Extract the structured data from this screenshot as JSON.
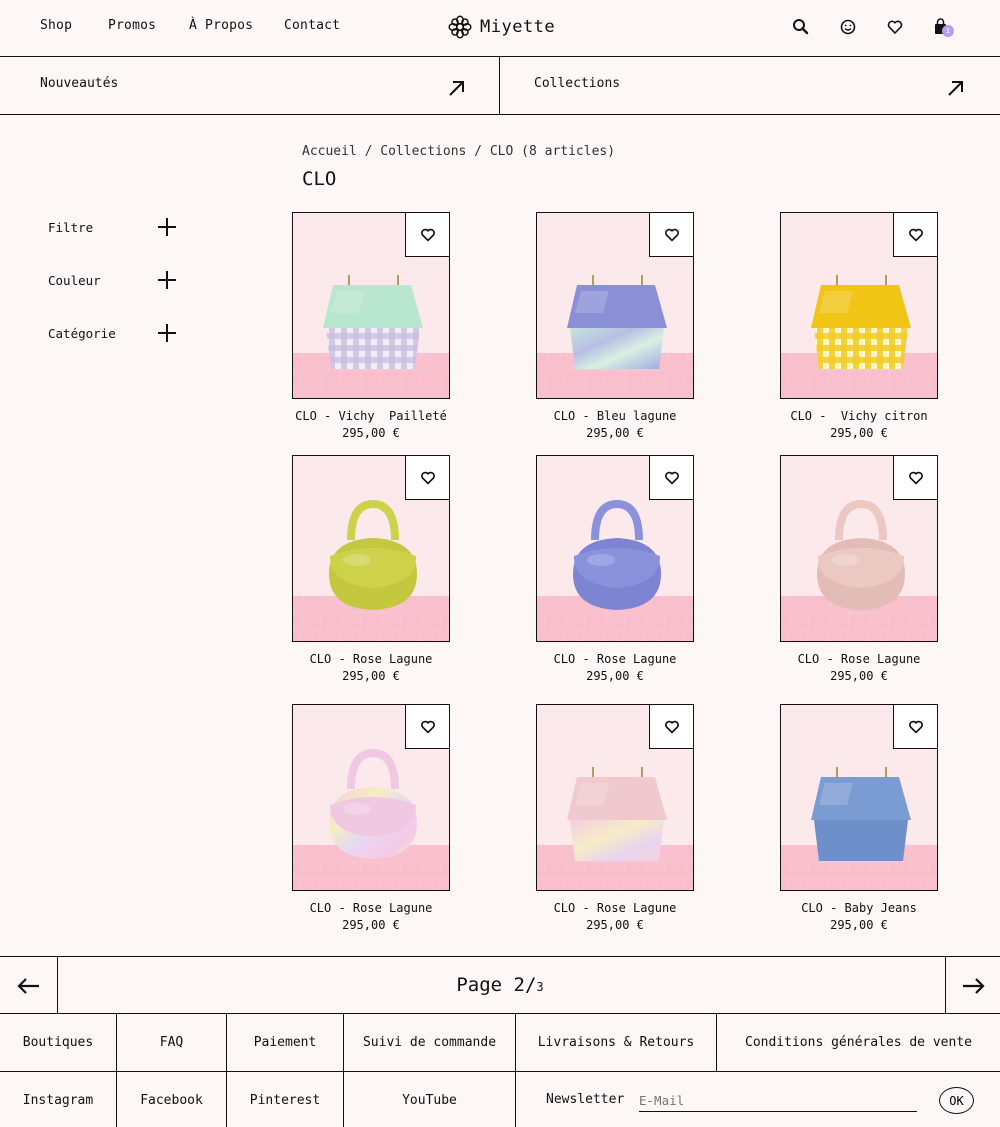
{
  "header": {
    "nav": [
      "Shop",
      "Promos",
      "À Propos",
      "Contact"
    ],
    "brand": "Miyette",
    "icons": [
      "search-icon",
      "account-icon",
      "heart-icon",
      "bag-icon"
    ],
    "cart_count": "1"
  },
  "subnav": {
    "left": "Nouveautés",
    "right": "Collections"
  },
  "breadcrumb": "Accueil / Collections / CLO (8 articles)",
  "title": "CLO",
  "filters": [
    "Filtre",
    "Couleur",
    "Catégorie"
  ],
  "products": [
    {
      "name": "CLO - Vichy  Pailleté",
      "price": "295,00 €",
      "shape": "flap",
      "top": "#b8e6cf",
      "bottom": "gingham-lilac"
    },
    {
      "name": "CLO - Bleu lagune",
      "price": "295,00 €",
      "shape": "flap",
      "top": "#8a8fd6",
      "bottom": "swirl-mint"
    },
    {
      "name": "CLO -  Vichy citron",
      "price": "295,00 €",
      "shape": "flap",
      "top": "#f1c515",
      "bottom": "gingham-yellow"
    },
    {
      "name": "CLO - Rose Lagune",
      "price": "295,00 €",
      "shape": "round",
      "top": "#cdd24a",
      "bottom": "#c3c83e"
    },
    {
      "name": "CLO - Rose Lagune",
      "price": "295,00 €",
      "shape": "round",
      "top": "#8a92dc",
      "bottom": "#7d85d2"
    },
    {
      "name": "CLO - Rose Lagune",
      "price": "295,00 €",
      "shape": "round",
      "top": "#ecc8c3",
      "bottom": "#e4bcb7"
    },
    {
      "name": "CLO - Rose Lagune",
      "price": "295,00 €",
      "shape": "round",
      "top": "#f0c8e2",
      "bottom": "swirl-pastel"
    },
    {
      "name": "CLO - Rose Lagune",
      "price": "295,00 €",
      "shape": "flap",
      "top": "#f0c9cf",
      "bottom": "swirl-pink"
    },
    {
      "name": "CLO - Baby Jeans",
      "price": "295,00 €",
      "shape": "flap",
      "top": "#7b9bd3",
      "bottom": "#6f8fca"
    }
  ],
  "pager": {
    "label": "Page 2/",
    "total": "3"
  },
  "footer": {
    "row1": [
      "Boutiques",
      "FAQ",
      "Paiement",
      "Suivi de commande",
      "Livraisons & Retours",
      "Conditions générales de vente"
    ],
    "row2": [
      "Instagram",
      "Facebook",
      "Pinterest",
      "YouTube"
    ],
    "newsletter_label": "Newsletter",
    "email_placeholder": "E-Mail",
    "ok_label": "OK"
  }
}
